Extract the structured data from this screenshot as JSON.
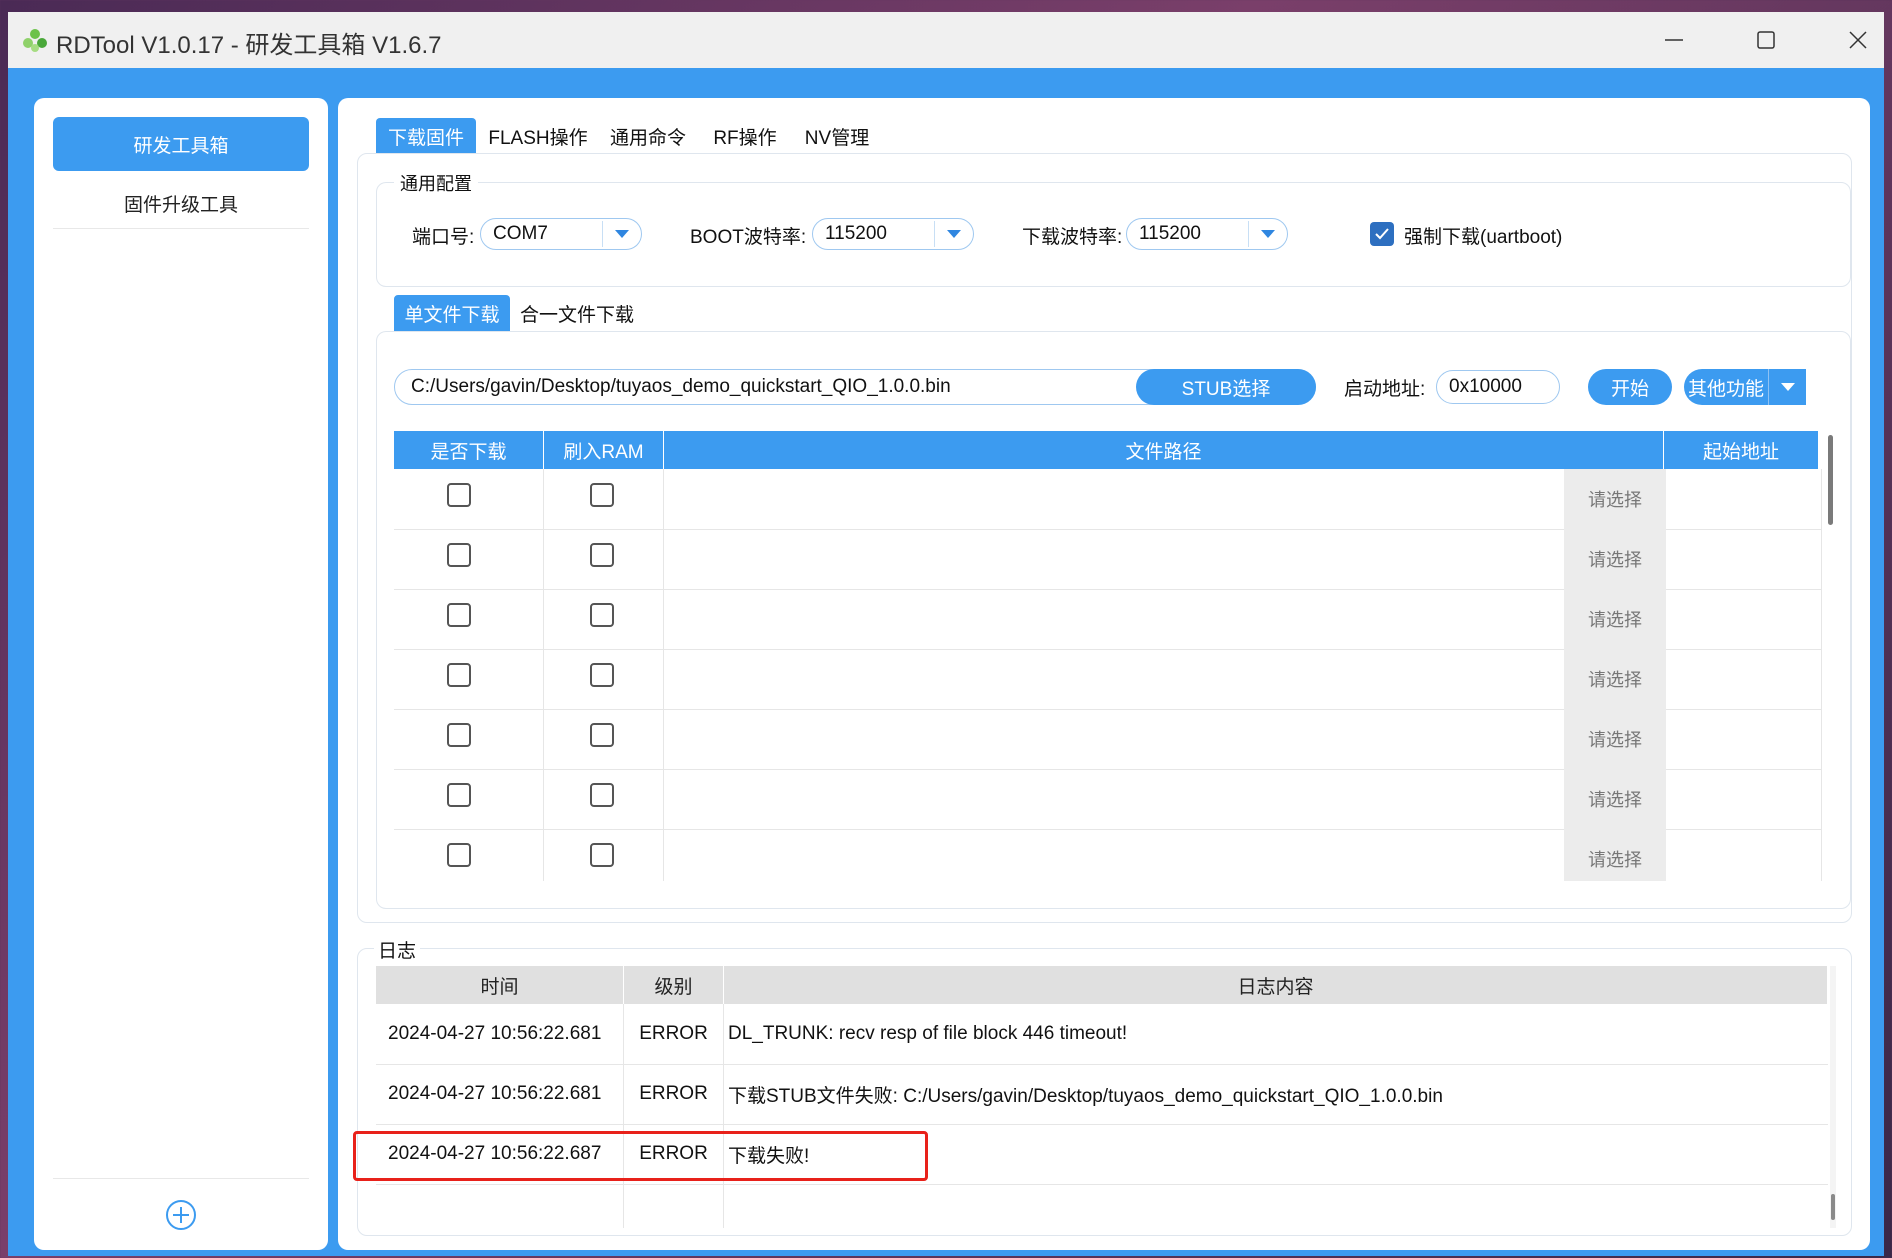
{
  "window": {
    "title": "RDTool V1.0.17 - 研发工具箱 V1.6.7",
    "controls": [
      "minimize",
      "maximize",
      "close"
    ]
  },
  "sidebar": {
    "items": [
      {
        "label": "研发工具箱",
        "active": true
      },
      {
        "label": "固件升级工具",
        "active": false
      }
    ],
    "add_icon": "plus-circle-icon"
  },
  "tabs": [
    {
      "label": "下载固件",
      "active": true
    },
    {
      "label": "FLASH操作",
      "active": false
    },
    {
      "label": "通用命令",
      "active": false
    },
    {
      "label": "RF操作",
      "active": false
    },
    {
      "label": "NV管理",
      "active": false
    }
  ],
  "config": {
    "group_title": "通用配置",
    "port_label": "端口号:",
    "port_value": "COM7",
    "boot_baud_label": "BOOT波特率:",
    "boot_baud_value": "115200",
    "dl_baud_label": "下载波特率:",
    "dl_baud_value": "115200",
    "force_download_label": "强制下载(uartboot)",
    "force_download_checked": true
  },
  "subtabs": [
    {
      "label": "单文件下载",
      "active": true
    },
    {
      "label": "合一文件下载",
      "active": false
    }
  ],
  "single": {
    "file_path": "C:/Users/gavin/Desktop/tuyaos_demo_quickstart_QIO_1.0.0.bin",
    "stub_button": "STUB选择",
    "start_addr_label": "启动地址:",
    "start_addr_value": "0x10000",
    "start_button": "开始",
    "other_button": "其他功能"
  },
  "file_table": {
    "headers": [
      "是否下载",
      "刷入RAM",
      "文件路径",
      "起始地址"
    ],
    "pick_label": "请选择",
    "rows": [
      {
        "download": false,
        "ram": false,
        "path": "",
        "address": ""
      },
      {
        "download": false,
        "ram": false,
        "path": "",
        "address": ""
      },
      {
        "download": false,
        "ram": false,
        "path": "",
        "address": ""
      },
      {
        "download": false,
        "ram": false,
        "path": "",
        "address": ""
      },
      {
        "download": false,
        "ram": false,
        "path": "",
        "address": ""
      },
      {
        "download": false,
        "ram": false,
        "path": "",
        "address": ""
      },
      {
        "download": false,
        "ram": false,
        "path": "",
        "address": ""
      }
    ]
  },
  "log": {
    "title": "日志",
    "headers": [
      "时间",
      "级别",
      "日志内容"
    ],
    "rows": [
      {
        "time": "2024-04-27 10:56:22.681",
        "level": "ERROR",
        "message": "DL_TRUNK: recv resp of file block 446 timeout!"
      },
      {
        "time": "2024-04-27 10:56:22.681",
        "level": "ERROR",
        "message": "下载STUB文件失败: C:/Users/gavin/Desktop/tuyaos_demo_quickstart_QIO_1.0.0.bin"
      },
      {
        "time": "2024-04-27 10:56:22.687",
        "level": "ERROR",
        "message": "下载失败!"
      }
    ],
    "highlight_color": "#e8211a"
  },
  "colors": {
    "accent": "#3c9bf0",
    "checkbox": "#2d6fc0"
  }
}
